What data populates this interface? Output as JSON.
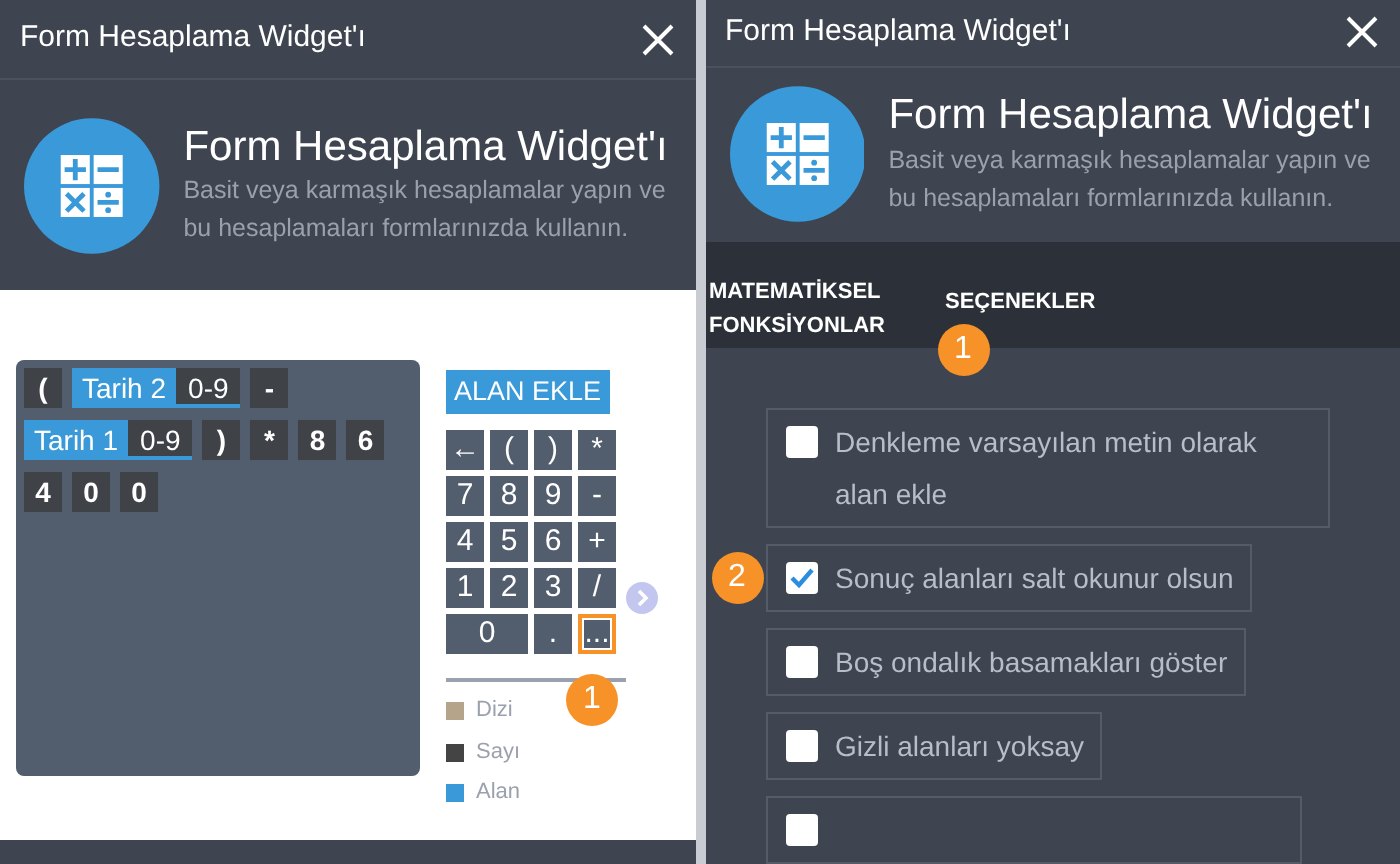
{
  "panels": [
    {
      "title": "Form Hesaplama Widget'ı",
      "header": {
        "name": "Form Hesaplama Widget'ı",
        "description": "Basit veya karmaşık hesaplamalar yapın ve bu hesaplamaları formlarınızda kullanın."
      },
      "editor": {
        "tokens": [
          {
            "kind": "symbol",
            "text": "("
          },
          {
            "kind": "field",
            "text": "Tarih 2",
            "range": "0-9"
          },
          {
            "kind": "symbol",
            "text": "-"
          },
          {
            "kind": "break"
          },
          {
            "kind": "field",
            "text": "Tarih 1",
            "range": "0-9"
          },
          {
            "kind": "symbol",
            "text": ")"
          },
          {
            "kind": "symbol",
            "text": "*"
          },
          {
            "kind": "number",
            "text": "8"
          },
          {
            "kind": "number",
            "text": "6"
          },
          {
            "kind": "break"
          },
          {
            "kind": "number",
            "text": "4"
          },
          {
            "kind": "number",
            "text": "0"
          },
          {
            "kind": "number",
            "text": "0"
          }
        ],
        "add_field_button": "ALAN EKLE",
        "keys": [
          {
            "label": "←",
            "highlighted": false,
            "wide": false
          },
          {
            "label": "(",
            "highlighted": false,
            "wide": false
          },
          {
            "label": ")",
            "highlighted": false,
            "wide": false
          },
          {
            "label": "*",
            "highlighted": false,
            "wide": false
          },
          {
            "label": "7",
            "highlighted": false,
            "wide": false
          },
          {
            "label": "8",
            "highlighted": false,
            "wide": false
          },
          {
            "label": "9",
            "highlighted": false,
            "wide": false
          },
          {
            "label": "-",
            "highlighted": false,
            "wide": false
          },
          {
            "label": "4",
            "highlighted": false,
            "wide": false
          },
          {
            "label": "5",
            "highlighted": false,
            "wide": false
          },
          {
            "label": "6",
            "highlighted": false,
            "wide": false
          },
          {
            "label": "+",
            "highlighted": false,
            "wide": false
          },
          {
            "label": "1",
            "highlighted": false,
            "wide": false
          },
          {
            "label": "2",
            "highlighted": false,
            "wide": false
          },
          {
            "label": "3",
            "highlighted": false,
            "wide": false
          },
          {
            "label": "/",
            "highlighted": false,
            "wide": false
          },
          {
            "label": "0",
            "highlighted": false,
            "wide": true
          },
          {
            "label": ".",
            "highlighted": false,
            "wide": false
          },
          {
            "label": "...",
            "highlighted": true,
            "wide": false
          }
        ],
        "callout": "1",
        "legend": [
          {
            "label": "Dizi",
            "color": "#b5a48a"
          },
          {
            "label": "Sayı",
            "color": "#444444"
          },
          {
            "label": "Alan",
            "color": "#3a9ad9"
          }
        ]
      }
    },
    {
      "title": "Form Hesaplama Widget'ı",
      "header": {
        "name": "Form Hesaplama Widget'ı",
        "description": "Basit veya karmaşık hesaplamalar yapın ve bu hesaplamaları formlarınızda kullanın."
      },
      "tabs": [
        {
          "label": "MATEMATİKSEL FONKSİYONLAR"
        },
        {
          "label": "SEÇENEKLER",
          "callout": "1"
        }
      ],
      "options": [
        {
          "label": "Denkleme varsayılan metin olarak alan ekle",
          "checked": false
        },
        {
          "label": "Sonuç alanları salt okunur olsun",
          "checked": true,
          "callout": "2"
        },
        {
          "label": "Boş ondalık basamakları göster",
          "checked": false
        },
        {
          "label": "Gizli alanları yoksay",
          "checked": false
        },
        {
          "checked": false
        }
      ]
    }
  ]
}
